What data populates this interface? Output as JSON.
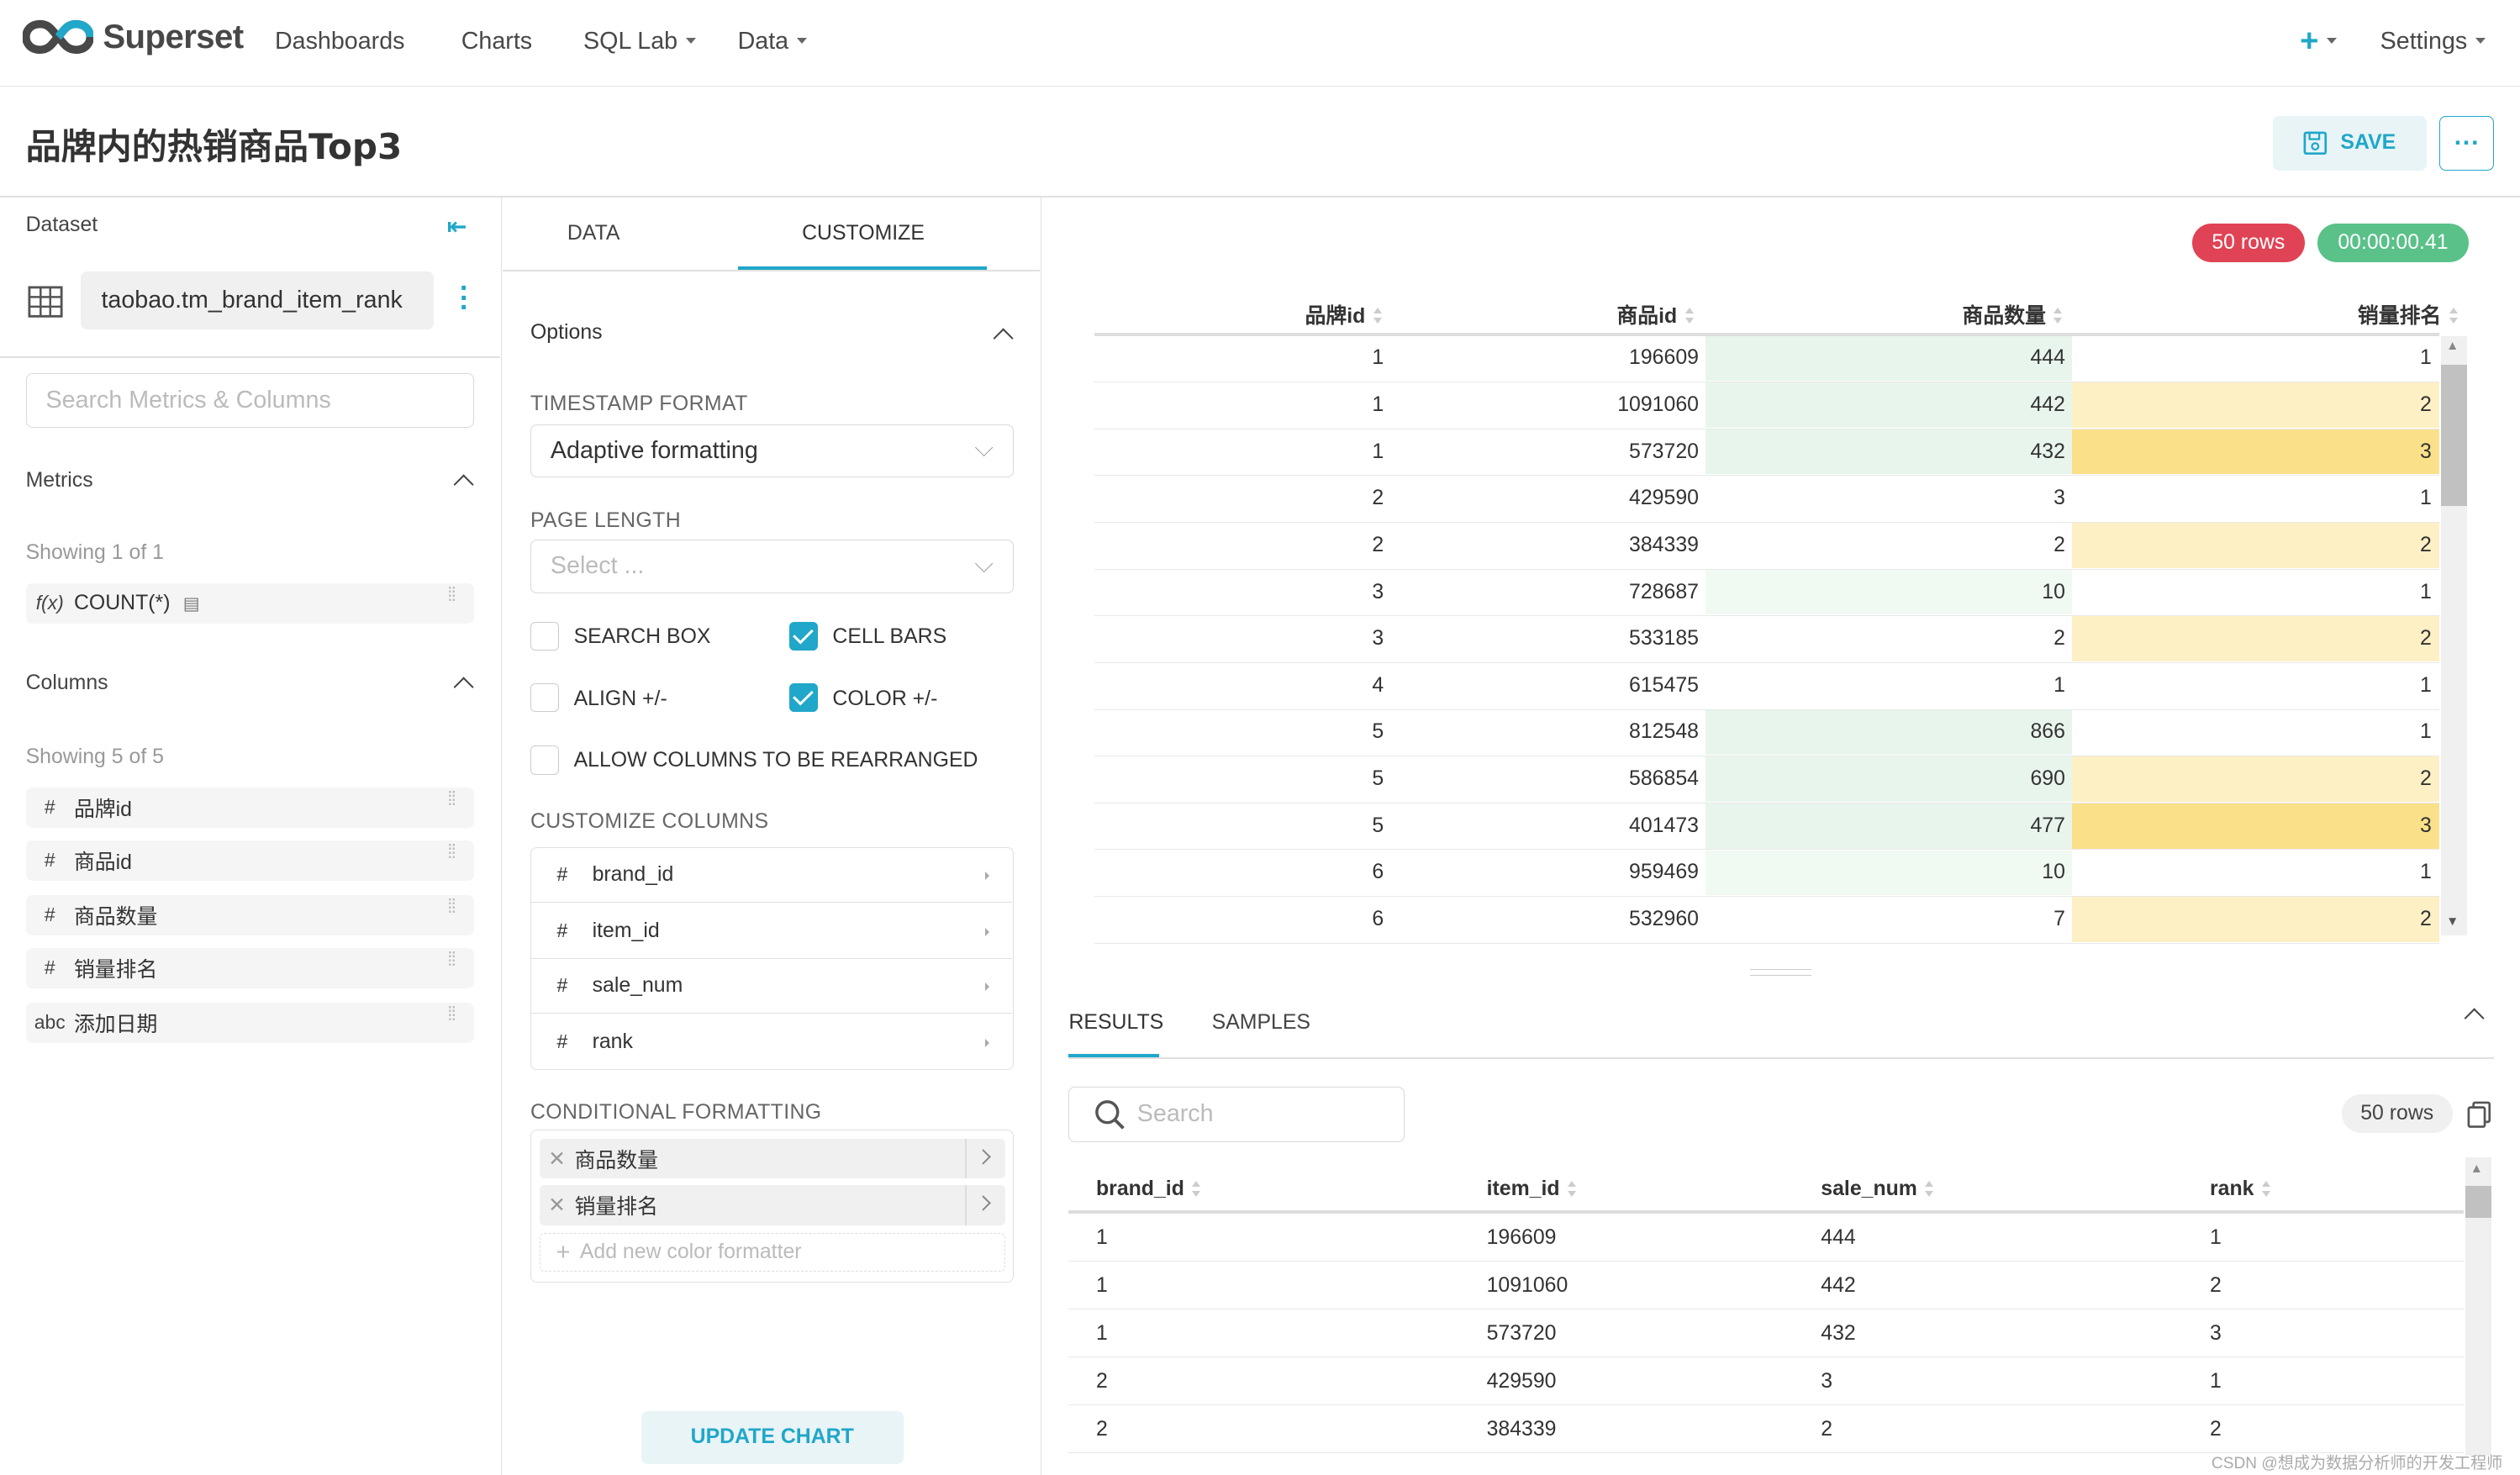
{
  "navbar": {
    "brand": "Superset",
    "items": [
      "Dashboards",
      "Charts",
      "SQL Lab",
      "Data"
    ],
    "settings": "Settings"
  },
  "header": {
    "title": "品牌内的热销商品Top3",
    "save_label": "SAVE",
    "more_label": "···"
  },
  "dataset": {
    "label": "Dataset",
    "name": "taobao.tm_brand_item_rank",
    "search_placeholder": "Search Metrics & Columns"
  },
  "metrics": {
    "title": "Metrics",
    "showing": "Showing 1 of 1",
    "items": [
      {
        "type": "f(x)",
        "name": "COUNT(*)"
      }
    ]
  },
  "columns": {
    "title": "Columns",
    "showing": "Showing 5 of 5",
    "items": [
      {
        "type": "#",
        "name": "品牌id"
      },
      {
        "type": "#",
        "name": "商品id"
      },
      {
        "type": "#",
        "name": "商品数量"
      },
      {
        "type": "#",
        "name": "销量排名"
      },
      {
        "type": "abc",
        "name": "添加日期"
      }
    ]
  },
  "config": {
    "tabs": [
      "DATA",
      "CUSTOMIZE"
    ],
    "active_tab": "CUSTOMIZE",
    "options_title": "Options",
    "timestamp_label": "TIMESTAMP FORMAT",
    "timestamp_value": "Adaptive formatting",
    "page_length_label": "PAGE LENGTH",
    "page_length_placeholder": "Select ...",
    "checkboxes": [
      {
        "label": "SEARCH BOX",
        "checked": false
      },
      {
        "label": "CELL BARS",
        "checked": true
      },
      {
        "label": "ALIGN +/-",
        "checked": false
      },
      {
        "label": "COLOR +/-",
        "checked": true
      },
      {
        "label": "ALLOW COLUMNS TO BE REARRANGED",
        "checked": false
      }
    ],
    "customize_columns_label": "CUSTOMIZE COLUMNS",
    "customize_columns": [
      "brand_id",
      "item_id",
      "sale_num",
      "rank"
    ],
    "conditional_label": "CONDITIONAL FORMATTING",
    "conditional_items": [
      "商品数量",
      "销量排名"
    ],
    "add_formatter": "Add new color formatter",
    "update_label": "UPDATE CHART"
  },
  "chart_data": {
    "type": "table",
    "row_count_badge": "50 rows",
    "time_badge": "00:00:00.41",
    "columns": [
      "品牌id",
      "商品id",
      "商品数量",
      "销量排名"
    ],
    "rows": [
      [
        1,
        196609,
        444,
        1
      ],
      [
        1,
        1091060,
        442,
        2
      ],
      [
        1,
        573720,
        432,
        3
      ],
      [
        2,
        429590,
        3,
        1
      ],
      [
        2,
        384339,
        2,
        2
      ],
      [
        3,
        728687,
        10,
        1
      ],
      [
        3,
        533185,
        2,
        2
      ],
      [
        4,
        615475,
        1,
        1
      ],
      [
        5,
        812548,
        866,
        1
      ],
      [
        5,
        586854,
        690,
        2
      ],
      [
        5,
        401473,
        477,
        3
      ],
      [
        6,
        959469,
        10,
        1
      ],
      [
        6,
        532960,
        7,
        2
      ]
    ],
    "colors": {
      "green": "#e8f5ec",
      "yellow_light": "#fdf0c4",
      "yellow_dark": "#fbe08a",
      "badge_red": "#e04355",
      "badge_green": "#5ac189"
    }
  },
  "results": {
    "tabs": [
      "RESULTS",
      "SAMPLES"
    ],
    "search_placeholder": "Search",
    "row_count": "50 rows",
    "columns": [
      "brand_id",
      "item_id",
      "sale_num",
      "rank"
    ],
    "rows": [
      [
        "1",
        "196609",
        "444",
        "1"
      ],
      [
        "1",
        "1091060",
        "442",
        "2"
      ],
      [
        "1",
        "573720",
        "432",
        "3"
      ],
      [
        "2",
        "429590",
        "3",
        "1"
      ],
      [
        "2",
        "384339",
        "2",
        "2"
      ]
    ]
  },
  "footer": "CSDN @想成为数据分析师的开发工程师"
}
